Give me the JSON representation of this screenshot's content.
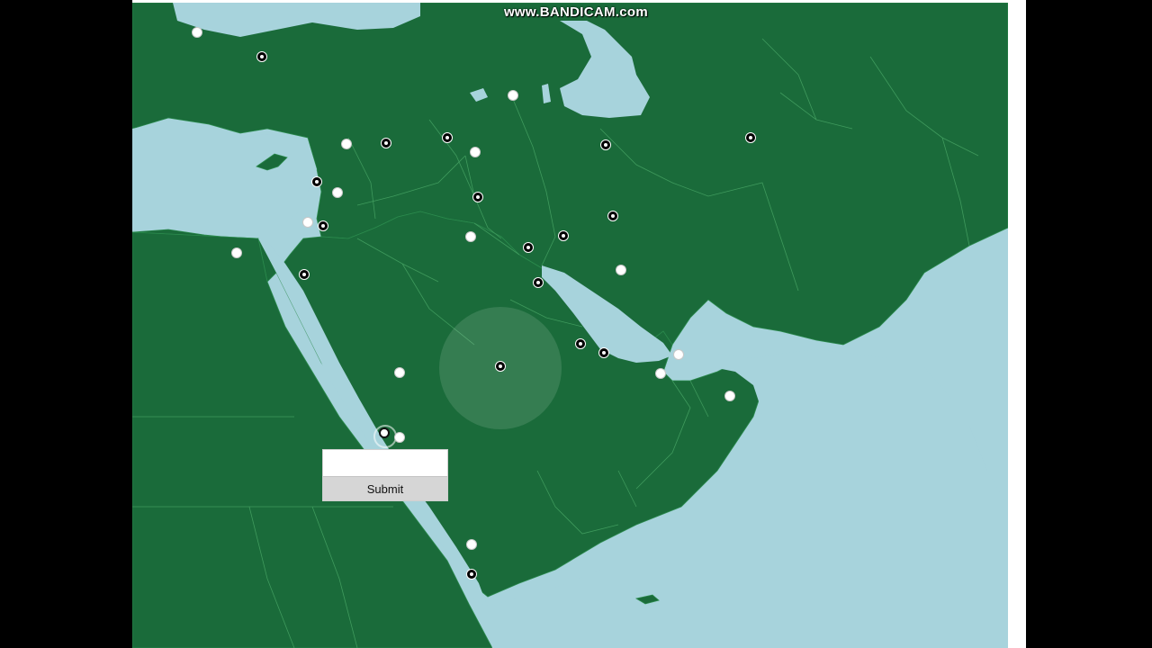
{
  "watermark": "www.BANDICAM.com",
  "colors": {
    "land": "#1a6b3a",
    "water": "#a7d3dc",
    "border": "#3f9a5d",
    "letterbox": "#000000"
  },
  "quiz": {
    "input_value": "",
    "submit_label": "Submit"
  },
  "markers": [
    {
      "id": "m1",
      "state": "unanswered"
    },
    {
      "id": "m2",
      "state": "answered"
    },
    {
      "id": "m3",
      "state": "unanswered"
    },
    {
      "id": "m4",
      "state": "unanswered"
    },
    {
      "id": "m5",
      "state": "answered"
    },
    {
      "id": "m6",
      "state": "answered"
    },
    {
      "id": "m7",
      "state": "unanswered"
    },
    {
      "id": "m8",
      "state": "answered"
    },
    {
      "id": "m9",
      "state": "answered"
    },
    {
      "id": "m10",
      "state": "unanswered"
    },
    {
      "id": "m11",
      "state": "answered"
    },
    {
      "id": "m12",
      "state": "answered"
    },
    {
      "id": "m13",
      "state": "unanswered"
    },
    {
      "id": "m14",
      "state": "answered"
    },
    {
      "id": "m15",
      "state": "unanswered"
    },
    {
      "id": "m16",
      "state": "answered"
    },
    {
      "id": "m17",
      "state": "answered"
    },
    {
      "id": "m18",
      "state": "answered"
    },
    {
      "id": "m19",
      "state": "answered"
    },
    {
      "id": "m20",
      "state": "unanswered"
    },
    {
      "id": "m21",
      "state": "answered"
    },
    {
      "id": "m22",
      "state": "answered"
    },
    {
      "id": "m23",
      "state": "answered"
    },
    {
      "id": "m24",
      "state": "unanswered"
    },
    {
      "id": "m25",
      "state": "unanswered"
    },
    {
      "id": "m26",
      "state": "unanswered"
    },
    {
      "id": "m27",
      "state": "answered"
    },
    {
      "id": "m28",
      "state": "unanswered"
    },
    {
      "id": "m29",
      "state": "active"
    },
    {
      "id": "m30",
      "state": "unanswered"
    },
    {
      "id": "m31",
      "state": "unanswered"
    },
    {
      "id": "m32",
      "state": "answered"
    }
  ]
}
